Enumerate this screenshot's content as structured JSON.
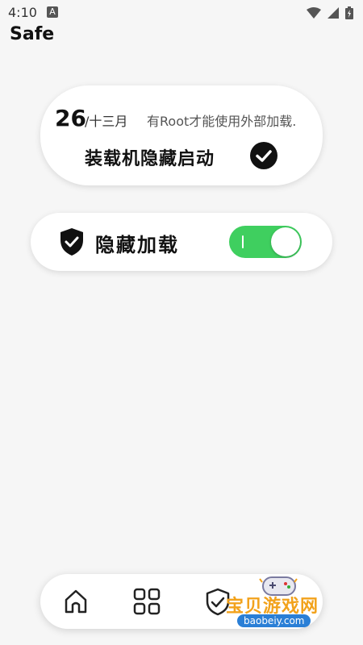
{
  "status_bar": {
    "time": "4:10",
    "notif_badge": "A"
  },
  "app": {
    "title": "Safe"
  },
  "date_card": {
    "day": "26",
    "month": "/十三月",
    "note": "有Root才能使用外部加载.",
    "loader_status": "装载机隐藏启动"
  },
  "hide_card": {
    "label": "隐藏加载",
    "toggle_on": true
  },
  "bottom_nav": {
    "items": [
      {
        "icon": "home-icon"
      },
      {
        "icon": "apps-grid-icon"
      },
      {
        "icon": "shield-check-icon"
      }
    ]
  },
  "watermark": {
    "text": "宝贝游戏网",
    "url": "baobeiy.com"
  },
  "colors": {
    "toggle_on": "#3fcf5f",
    "background": "#f6f6f6",
    "watermark": "#f2a21b"
  }
}
